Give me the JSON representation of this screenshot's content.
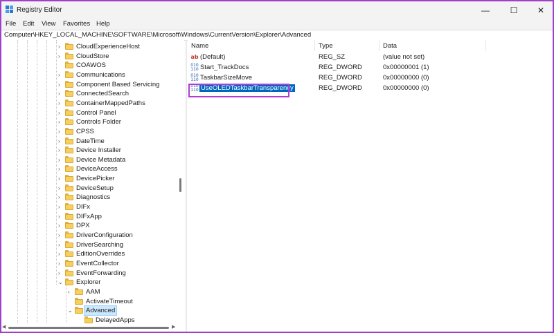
{
  "window": {
    "title": "Registry Editor",
    "controls": {
      "minimize": "—",
      "maximize": "☐",
      "close": "✕"
    }
  },
  "menu": [
    "File",
    "Edit",
    "View",
    "Favorites",
    "Help"
  ],
  "address": "Computer\\HKEY_LOCAL_MACHINE\\SOFTWARE\\Microsoft\\Windows\\CurrentVersion\\Explorer\\Advanced",
  "tree": {
    "items": [
      {
        "label": "CloudExperienceHost",
        "state": "collapsed"
      },
      {
        "label": "CloudStore",
        "state": "collapsed"
      },
      {
        "label": "COAWOS",
        "state": "none"
      },
      {
        "label": "Communications",
        "state": "collapsed"
      },
      {
        "label": "Component Based Servicing",
        "state": "collapsed"
      },
      {
        "label": "ConnectedSearch",
        "state": "collapsed"
      },
      {
        "label": "ContainerMappedPaths",
        "state": "collapsed"
      },
      {
        "label": "Control Panel",
        "state": "collapsed"
      },
      {
        "label": "Controls Folder",
        "state": "collapsed"
      },
      {
        "label": "CPSS",
        "state": "collapsed"
      },
      {
        "label": "DateTime",
        "state": "collapsed"
      },
      {
        "label": "Device Installer",
        "state": "collapsed"
      },
      {
        "label": "Device Metadata",
        "state": "collapsed"
      },
      {
        "label": "DeviceAccess",
        "state": "collapsed"
      },
      {
        "label": "DevicePicker",
        "state": "collapsed"
      },
      {
        "label": "DeviceSetup",
        "state": "collapsed"
      },
      {
        "label": "Diagnostics",
        "state": "collapsed"
      },
      {
        "label": "DIFx",
        "state": "collapsed"
      },
      {
        "label": "DIFxApp",
        "state": "collapsed"
      },
      {
        "label": "DPX",
        "state": "collapsed"
      },
      {
        "label": "DriverConfiguration",
        "state": "collapsed"
      },
      {
        "label": "DriverSearching",
        "state": "collapsed"
      },
      {
        "label": "EditionOverrides",
        "state": "collapsed"
      },
      {
        "label": "EventCollector",
        "state": "collapsed"
      },
      {
        "label": "EventForwarding",
        "state": "collapsed"
      },
      {
        "label": "Explorer",
        "state": "expanded"
      },
      {
        "label": "AAM",
        "state": "collapsed"
      },
      {
        "label": "ActivateTimeout",
        "state": "none"
      },
      {
        "label": "Advanced",
        "state": "expanded"
      },
      {
        "label": "DelayedApps",
        "state": "none"
      }
    ]
  },
  "list": {
    "headers": {
      "name": "Name",
      "type": "Type",
      "data": "Data"
    },
    "rows": [
      {
        "name": "(Default)",
        "type": "REG_SZ",
        "data": "(value not set)",
        "icon": "string-value-icon"
      },
      {
        "name": "Start_TrackDocs",
        "type": "REG_DWORD",
        "data": "0x00000001 (1)",
        "icon": "dword-value-icon"
      },
      {
        "name": "TaskbarSizeMove",
        "type": "REG_DWORD",
        "data": "0x00000000 (0)",
        "icon": "dword-value-icon"
      },
      {
        "name": "UseOLEDTaskbarTransparency",
        "type": "REG_DWORD",
        "data": "0x00000000 (0)",
        "icon": "dword-value-icon"
      }
    ]
  },
  "colors": {
    "accent": "#0067c0",
    "highlight_border": "#b43cd6",
    "tree_selection": "#cce8ff",
    "folder": "#f6cf5c"
  }
}
